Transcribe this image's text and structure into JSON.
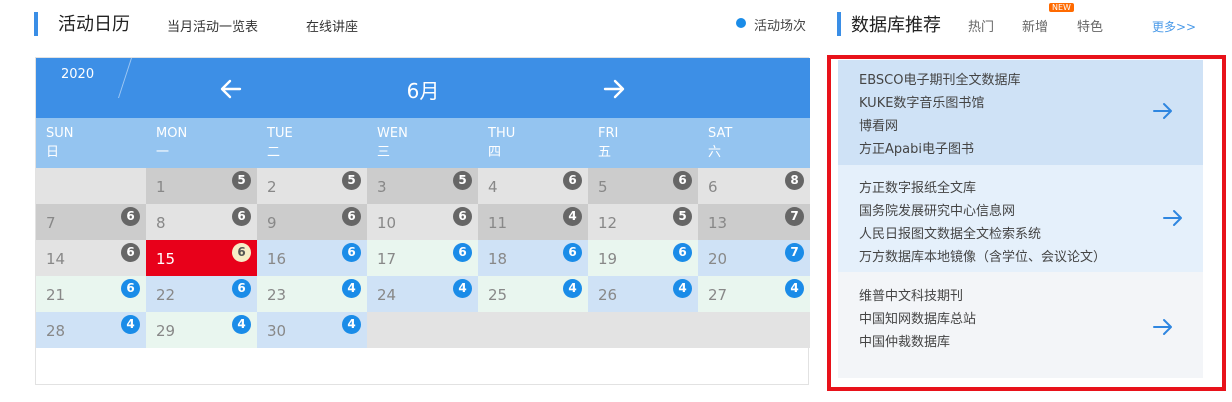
{
  "left_header": {
    "title": "活动日历",
    "link_monthly": "当月活动一览表",
    "link_lectures": "在线讲座",
    "legend_text": "活动场次",
    "accent_color": "#3a8ee6"
  },
  "calendar": {
    "year": "2020",
    "month": "6月",
    "prev_icon": "arrow-left-icon",
    "next_icon": "arrow-right-icon",
    "weekdays": [
      {
        "en": "SUN",
        "cn": "日"
      },
      {
        "en": "MON",
        "cn": "一"
      },
      {
        "en": "TUE",
        "cn": "二"
      },
      {
        "en": "WEN",
        "cn": "三"
      },
      {
        "en": "THU",
        "cn": "四"
      },
      {
        "en": "FRI",
        "cn": "五"
      },
      {
        "en": "SAT",
        "cn": "六"
      }
    ],
    "days": [
      {
        "day": "1",
        "count": "5"
      },
      {
        "day": "2",
        "count": "5"
      },
      {
        "day": "3",
        "count": "5"
      },
      {
        "day": "4",
        "count": "6"
      },
      {
        "day": "5",
        "count": "6"
      },
      {
        "day": "6",
        "count": "8"
      },
      {
        "day": "7",
        "count": "6"
      },
      {
        "day": "8",
        "count": "6"
      },
      {
        "day": "9",
        "count": "6"
      },
      {
        "day": "10",
        "count": "6"
      },
      {
        "day": "11",
        "count": "4"
      },
      {
        "day": "12",
        "count": "5"
      },
      {
        "day": "13",
        "count": "7"
      },
      {
        "day": "14",
        "count": "6"
      },
      {
        "day": "15",
        "count": "6"
      },
      {
        "day": "16",
        "count": "6"
      },
      {
        "day": "17",
        "count": "6"
      },
      {
        "day": "18",
        "count": "6"
      },
      {
        "day": "19",
        "count": "6"
      },
      {
        "day": "20",
        "count": "7"
      },
      {
        "day": "21",
        "count": "6"
      },
      {
        "day": "22",
        "count": "6"
      },
      {
        "day": "23",
        "count": "4"
      },
      {
        "day": "24",
        "count": "4"
      },
      {
        "day": "25",
        "count": "4"
      },
      {
        "day": "26",
        "count": "4"
      },
      {
        "day": "27",
        "count": "4"
      },
      {
        "day": "28",
        "count": "4"
      },
      {
        "day": "29",
        "count": "4"
      },
      {
        "day": "30",
        "count": "4"
      }
    ],
    "today": "15"
  },
  "right_header": {
    "title": "数据库推荐",
    "tabs": [
      "热门",
      "新增",
      "特色"
    ],
    "new_badge": "NEW",
    "more": "更多>>"
  },
  "databases": [
    {
      "items": [
        "EBSCO电子期刊全文数据库",
        "KUKE数字音乐图书馆",
        "博看网",
        "方正Apabi电子图书"
      ]
    },
    {
      "items": [
        "方正数字报纸全文库",
        "国务院发展研究中心信息网",
        "人民日报图文数据全文检索系统",
        "万方数据库本地镜像（含学位、会议论文）"
      ]
    },
    {
      "items": [
        "维普中文科技期刊",
        "中国知网数据库总站",
        "中国仲裁数据库"
      ]
    }
  ],
  "colors": {
    "highlight_frame": "#e8121a",
    "today": "#e8001a",
    "badge_blue": "#1a8ce8",
    "badge_gray": "#666666"
  }
}
